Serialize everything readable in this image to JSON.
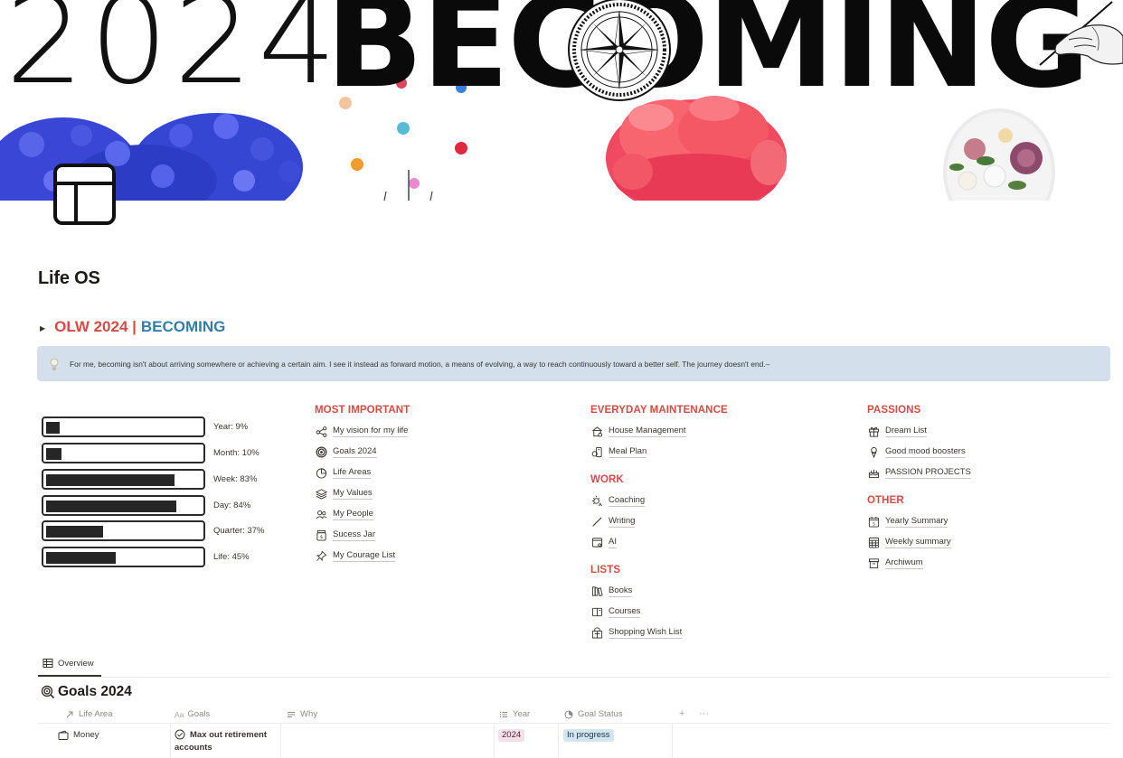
{
  "cover": {
    "year_text": "2024",
    "word_text": "BECOMING"
  },
  "page": {
    "title": "Life OS"
  },
  "olw_heading": {
    "part1": "OLW 2024 |",
    "part2": "BECOMING",
    "part1_color": "#d44c47",
    "part2_color": "#337ea9"
  },
  "callout": {
    "icon": "lightbulb-icon",
    "text": "For me, becoming isn't about arriving somewhere or achieving a certain aim. I see it instead as forward motion, a means of evolving, a way to reach continuously toward a better self. The journey doesn't end.–",
    "background": "#d3e0eb"
  },
  "progress": [
    {
      "label": "Year: 9%",
      "percent": 9
    },
    {
      "label": "Month: 10%",
      "percent": 10
    },
    {
      "label": "Week: 83%",
      "percent": 83
    },
    {
      "label": "Day: 84%",
      "percent": 84
    },
    {
      "label": "Quarter: 37%",
      "percent": 37
    },
    {
      "label": "Life: 45%",
      "percent": 45
    }
  ],
  "sections": {
    "most_important": {
      "heading": "MOST IMPORTANT",
      "items": [
        {
          "label": "My vision for my life",
          "icon": "share-nodes-icon"
        },
        {
          "label": "Goals 2024",
          "icon": "target-icon"
        },
        {
          "label": "Life Areas",
          "icon": "pie-chart-icon"
        },
        {
          "label": "My Values",
          "icon": "stack-icon"
        },
        {
          "label": "My People",
          "icon": "people-icon"
        },
        {
          "label": "Sucess Jar",
          "icon": "jar-icon"
        },
        {
          "label": "My Courage List",
          "icon": "pin-icon"
        }
      ]
    },
    "everyday": {
      "heading": "EVERYDAY MAINTENANCE",
      "items": [
        {
          "label": "House Management",
          "icon": "house-icon"
        },
        {
          "label": "Meal Plan",
          "icon": "meal-icon"
        }
      ]
    },
    "work": {
      "heading": "WORK",
      "items": [
        {
          "label": "Coaching",
          "icon": "sun-person-icon"
        },
        {
          "label": "Writing",
          "icon": "pen-icon"
        },
        {
          "label": "AI",
          "icon": "browser-icon"
        }
      ]
    },
    "lists": {
      "heading": "LISTS",
      "items": [
        {
          "label": "Books",
          "icon": "books-icon"
        },
        {
          "label": "Courses",
          "icon": "open-book-icon"
        },
        {
          "label": "Shopping Wish List",
          "icon": "shopping-icon"
        }
      ]
    },
    "passions": {
      "heading": "PASSIONS",
      "items": [
        {
          "label": "Dream List",
          "icon": "gift-icon"
        },
        {
          "label": "Good mood boosters",
          "icon": "ice-cream-icon"
        },
        {
          "label": "PASSION PROJECTS",
          "icon": "cake-icon"
        }
      ]
    },
    "other": {
      "heading": "OTHER",
      "items": [
        {
          "label": "Yearly Summary",
          "icon": "calendar-icon"
        },
        {
          "label": "Weekly summary",
          "icon": "calendar-grid-icon"
        },
        {
          "label": "Archiwum",
          "icon": "archive-icon"
        }
      ]
    }
  },
  "database": {
    "view_tab": "Overview",
    "title": "Goals 2024",
    "columns": {
      "life_area": "Life Area",
      "goals": "Goals",
      "why": "Why",
      "year": "Year",
      "status": "Goal Status",
      "add": "+",
      "more": "···"
    },
    "rows": [
      {
        "life_area": "Money",
        "goal_line1": "Max out retirement",
        "goal_line2": "accounts",
        "why": "",
        "year": "2024",
        "year_color": "#f5e0e9",
        "status": "In progress",
        "status_color": "#d3e5ef"
      }
    ]
  }
}
